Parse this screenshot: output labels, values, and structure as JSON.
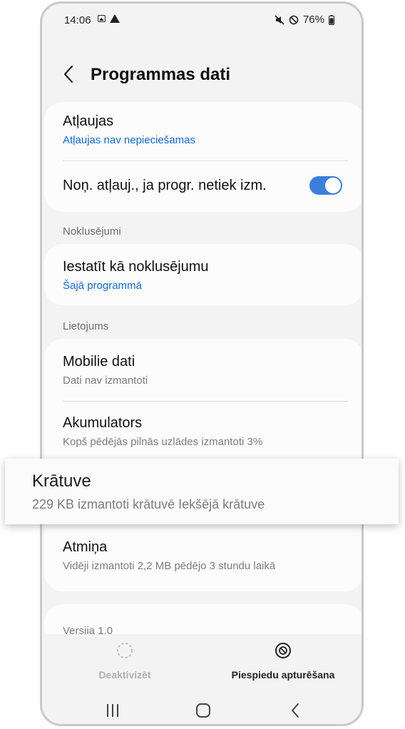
{
  "status_bar": {
    "time": "14:06",
    "battery": "76%"
  },
  "header": {
    "title": "Programmas dati"
  },
  "card_permissions": {
    "permissions_title": "Atļaujas",
    "permissions_sub": "Atļaujas nav nepieciešamas",
    "remove_perms_label": "Noņ. atļauj., ja progr. netiek izm.",
    "remove_perms_toggle_on": true
  },
  "sections": {
    "defaults_label": "Noklusējumi",
    "usage_label": "Lietojums"
  },
  "card_defaults": {
    "title": "Iestatīt kā noklusējumu",
    "sub": "Šajā programmā"
  },
  "card_usage": {
    "mobile_data_title": "Mobilie dati",
    "mobile_data_sub": "Dati nav izmantoti",
    "battery_title": "Akumulators",
    "battery_sub": "Kopš pēdējās pilnās uzlādes izmantoti 3%",
    "memory_title": "Atmiņa",
    "memory_sub": "Vidēji izmantoti 2,2 MB pēdējo 3 stundu laikā"
  },
  "highlight_storage": {
    "title": "Krātuve",
    "sub": "229 KB izmantoti krātuvē Iekšējā krātuve"
  },
  "version": {
    "text": "Versija 1.0"
  },
  "bottom_actions": {
    "deactivate_label": "Deaktivizēt",
    "force_stop_label": "Piespiedu apturēšana"
  },
  "colors": {
    "accent": "#3c7fdb",
    "link_blue": "#1469c8"
  }
}
